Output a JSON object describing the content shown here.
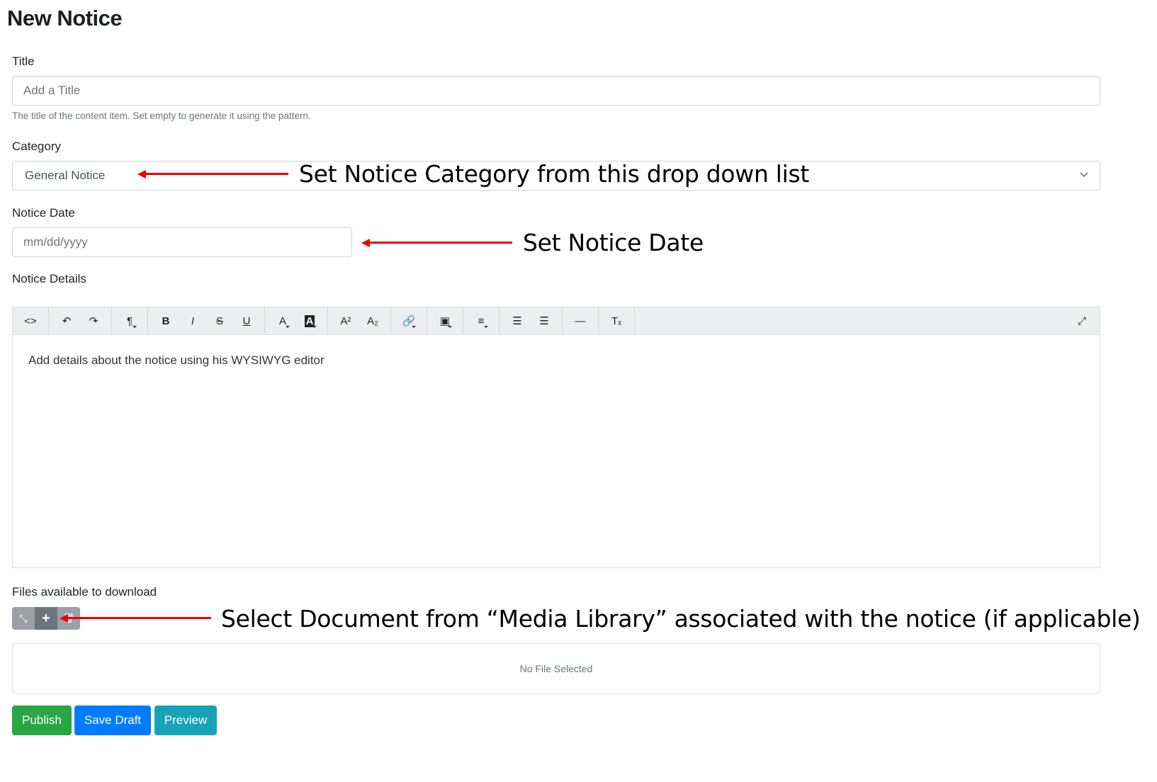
{
  "page": {
    "title": "New Notice"
  },
  "fields": {
    "title": {
      "label": "Title",
      "placeholder": "Add a Title",
      "value": "",
      "help": "The title of the content item. Set empty to generate it using the pattern."
    },
    "category": {
      "label": "Category",
      "selected": "General Notice"
    },
    "notice_date": {
      "label": "Notice Date",
      "placeholder": "mm/dd/yyyy",
      "value": ""
    },
    "notice_details": {
      "label": "Notice Details",
      "content": "Add details about the notice using his WYSIWYG editor"
    },
    "files": {
      "label": "Files available to download",
      "empty_text": "No File Selected"
    }
  },
  "toolbar": {
    "groups": [
      [
        {
          "name": "code-view",
          "glyph": "<>"
        }
      ],
      [
        {
          "name": "undo",
          "glyph": "↶"
        },
        {
          "name": "redo",
          "glyph": "↷"
        }
      ],
      [
        {
          "name": "paragraph-style",
          "glyph": "¶",
          "caret": true
        }
      ],
      [
        {
          "name": "bold",
          "glyph": "B"
        },
        {
          "name": "italic",
          "glyph": "I"
        },
        {
          "name": "strikethrough",
          "glyph": "S"
        },
        {
          "name": "underline",
          "glyph": "U"
        }
      ],
      [
        {
          "name": "text-color",
          "glyph": "A",
          "caret": true
        },
        {
          "name": "background-color",
          "glyph": "A",
          "caret": true
        }
      ],
      [
        {
          "name": "superscript",
          "glyph": "A²"
        },
        {
          "name": "subscript",
          "glyph": "A₂"
        }
      ],
      [
        {
          "name": "link",
          "glyph": "🔗",
          "caret": true
        }
      ],
      [
        {
          "name": "image",
          "glyph": "▣",
          "caret": true
        }
      ],
      [
        {
          "name": "align",
          "glyph": "≡",
          "caret": true
        }
      ],
      [
        {
          "name": "unordered-list",
          "glyph": "☰"
        },
        {
          "name": "ordered-list",
          "glyph": "☰"
        }
      ],
      [
        {
          "name": "horizontal-rule",
          "glyph": "—"
        }
      ],
      [
        {
          "name": "clear-format",
          "glyph": "Tₓ"
        }
      ]
    ],
    "fullscreen_glyph": "⤢"
  },
  "file_buttons": {
    "collapse": "⤡",
    "add": "+",
    "remove": "🗑"
  },
  "actions": {
    "publish": "Publish",
    "save_draft": "Save Draft",
    "preview": "Preview"
  },
  "annotations": {
    "category": "Set Notice Category from this drop down list",
    "date": "Set Notice Date",
    "files": "Select Document from “Media Library” associated with the notice (if applicable)"
  },
  "colors": {
    "publish": "#28a745",
    "save_draft": "#007bff",
    "preview": "#17a2b8",
    "annotation_arrow": "#e00000"
  }
}
